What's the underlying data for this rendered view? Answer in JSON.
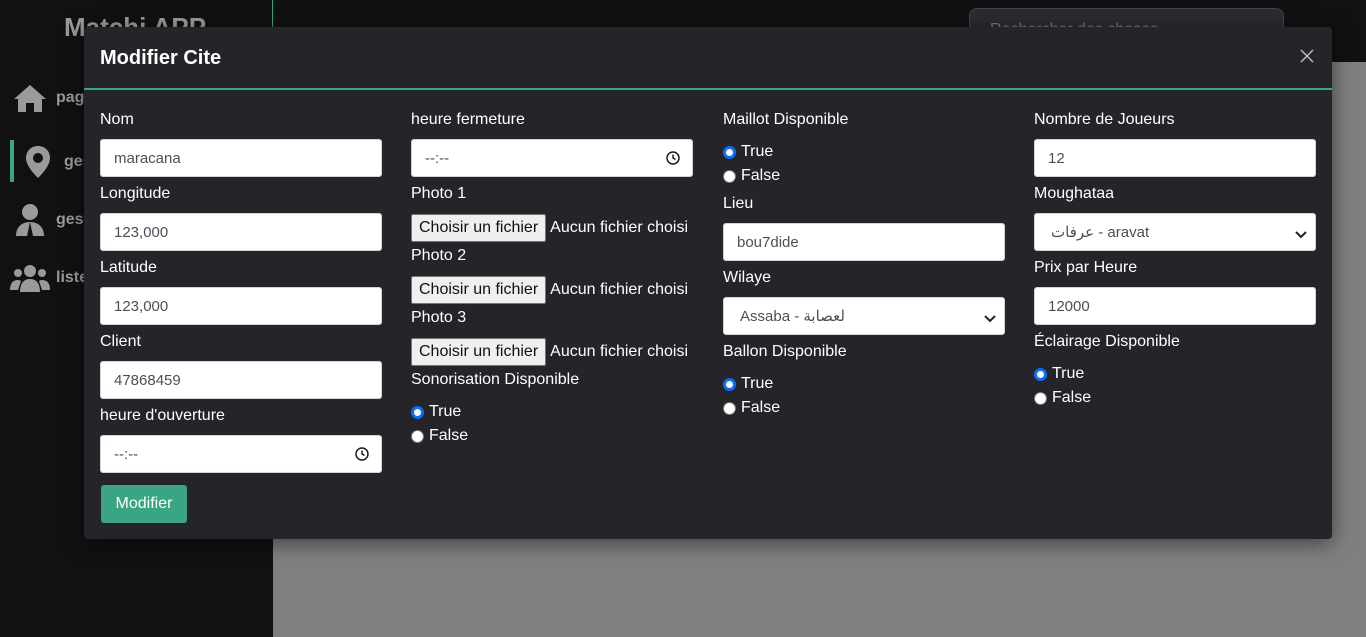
{
  "app": {
    "title": "Matchi APP"
  },
  "sidebar": {
    "items": [
      {
        "label": "pag",
        "icon": "home-icon"
      },
      {
        "label": "ges",
        "icon": "map-pin-icon"
      },
      {
        "label": "gesti",
        "icon": "user-tie-icon"
      },
      {
        "label": "liste",
        "icon": "users-icon"
      }
    ]
  },
  "search": {
    "placeholder": "Rechercher des choses"
  },
  "modal": {
    "title": "Modifier Cite",
    "submit_label": "Modifier",
    "fields": {
      "nom": {
        "label": "Nom",
        "value": "maracana"
      },
      "longitude": {
        "label": "Longitude",
        "value": "123,000"
      },
      "latitude": {
        "label": "Latitude",
        "value": "123,000"
      },
      "client": {
        "label": "Client",
        "value": "47868459"
      },
      "heure_ouverture": {
        "label": "heure d'ouverture",
        "value": "--:--"
      },
      "heure_fermeture": {
        "label": "heure fermeture",
        "value": "--:--"
      },
      "photo1": {
        "label": "Photo 1",
        "button": "Choisir un fichier",
        "status": "Aucun fichier choisi"
      },
      "photo2": {
        "label": "Photo 2",
        "button": "Choisir un fichier",
        "status": "Aucun fichier choisi"
      },
      "photo3": {
        "label": "Photo 3",
        "button": "Choisir un fichier",
        "status": "Aucun fichier choisi"
      },
      "sonorisation": {
        "label": "Sonorisation Disponible",
        "options": [
          "True",
          "False"
        ],
        "selected": "True"
      },
      "maillot": {
        "label": "Maillot Disponible",
        "options": [
          "True",
          "False"
        ],
        "selected": "True"
      },
      "lieu": {
        "label": "Lieu",
        "value": "bou7dide"
      },
      "wilaye": {
        "label": "Wilaye",
        "value": "Assaba - لعصابة"
      },
      "ballon": {
        "label": "Ballon Disponible",
        "options": [
          "True",
          "False"
        ],
        "selected": "True"
      },
      "nombre_joueurs": {
        "label": "Nombre de Joueurs",
        "value": "12"
      },
      "moughataa": {
        "label": "Moughataa",
        "value": "عرفات - aravat"
      },
      "prix_heure": {
        "label": "Prix par Heure",
        "value": "12000"
      },
      "eclairage": {
        "label": "Éclairage Disponible",
        "options": [
          "True",
          "False"
        ],
        "selected": "True"
      }
    }
  },
  "colors": {
    "accent": "#3aa583",
    "modal_bg": "#252529",
    "sidebar_bg": "#111113",
    "radio_checked": "#0b6ef5"
  }
}
